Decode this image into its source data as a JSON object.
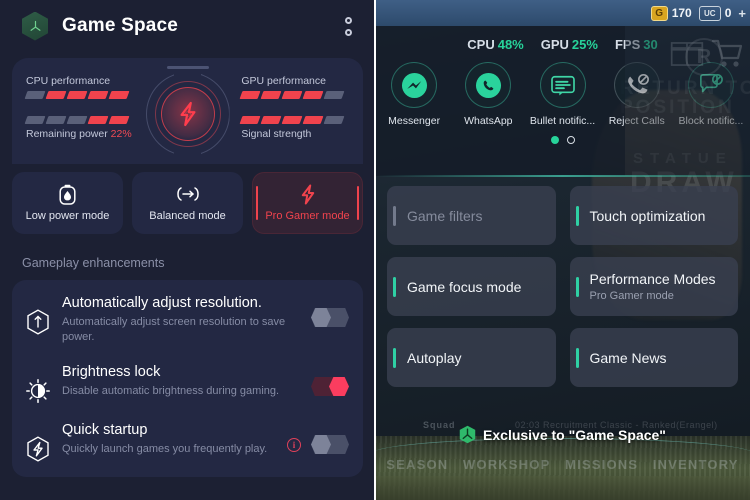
{
  "left": {
    "header": {
      "title": "Game Space",
      "logo_icon": "game-space-logo-icon",
      "menu_icon": "two-dot-menu-icon"
    },
    "stats": {
      "cpu": {
        "label": "CPU performance",
        "segments_on": 4,
        "segments_total": 5
      },
      "power": {
        "label": "Remaining power",
        "value": "22%",
        "segments_on": 2,
        "segments_total": 5
      },
      "gpu": {
        "label": "GPU performance",
        "segments_on": 4,
        "segments_total": 5
      },
      "signal": {
        "label": "Signal strength",
        "segments_on": 4,
        "segments_total": 5
      },
      "gauge_caption": "Pro Gamer mode",
      "gauge_icon": "lightning-bolt-icon",
      "accent_color": "#f0434d"
    },
    "modes": [
      {
        "label": "Low power mode",
        "icon": "battery-drop-icon",
        "active": false
      },
      {
        "label": "Balanced mode",
        "icon": "balance-arrows-icon",
        "active": false
      },
      {
        "label": "Pro Gamer mode",
        "icon": "lightning-bolt-icon",
        "active": true
      }
    ],
    "section_title": "Gameplay enhancements",
    "enhancements": [
      {
        "title": "Automatically adjust resolution.",
        "desc": "Automatically adjust screen resolution to save power.",
        "icon": "resolution-hexagon-icon",
        "toggle": "off",
        "info": false
      },
      {
        "title": "Brightness lock",
        "desc": "Disable automatic brightness during gaming.",
        "icon": "brightness-icon",
        "toggle": "on",
        "info": false
      },
      {
        "title": "Quick startup",
        "desc": "Quickly launch games you frequently play.",
        "icon": "quick-startup-bolt-icon",
        "toggle": "off",
        "info": true,
        "info_label": "i"
      }
    ]
  },
  "right": {
    "hud": {
      "gold_badge": "G",
      "gold_value": "170",
      "uc_badge": "UC",
      "uc_value": "0",
      "plus": "+",
      "shop_icon": "shop-cart-icon",
      "crate_icon": "crate-icon",
      "rank_icon": "rank-badge-icon"
    },
    "performance": [
      {
        "label": "CPU",
        "value": "48%"
      },
      {
        "label": "GPU",
        "value": "25%"
      },
      {
        "label": "FPS",
        "value": "30"
      }
    ],
    "perf_value_color": "#27d39a",
    "shortcuts": [
      {
        "label": "Messenger",
        "icon": "messenger-icon"
      },
      {
        "label": "WhatsApp",
        "icon": "whatsapp-icon"
      },
      {
        "label": "Bullet notific...",
        "icon": "bullet-notification-icon"
      },
      {
        "label": "Reject Calls",
        "icon": "reject-call-icon"
      },
      {
        "label": "Block notific...",
        "icon": "block-notification-icon"
      }
    ],
    "page_dots": {
      "count": 2,
      "active_index": 0
    },
    "cards": [
      {
        "title": "Game filters",
        "sub": "",
        "disabled": true
      },
      {
        "title": "Touch optimization",
        "sub": "",
        "disabled": false
      },
      {
        "title": "Game focus mode",
        "sub": "",
        "disabled": false
      },
      {
        "title": "Performance Modes",
        "sub": "Pro Gamer mode",
        "disabled": false
      },
      {
        "title": "Autoplay",
        "sub": "",
        "disabled": false
      },
      {
        "title": "Game News",
        "sub": "",
        "disabled": false
      }
    ],
    "exclusive": {
      "text": "Exclusive to \"Game Space\"",
      "logo_icon": "game-space-logo-icon"
    },
    "game_nav": [
      "SEASON",
      "WORKSHOP",
      "MISSIONS",
      "INVENTORY"
    ],
    "game_bg_text": {
      "return": "RETURN TO",
      "position": "POSITION",
      "statue": "STATUE",
      "draw": "DRAW",
      "squad": "Squad",
      "match": "02:03  Recruitment Classic - Ranked(Erangel)"
    }
  }
}
